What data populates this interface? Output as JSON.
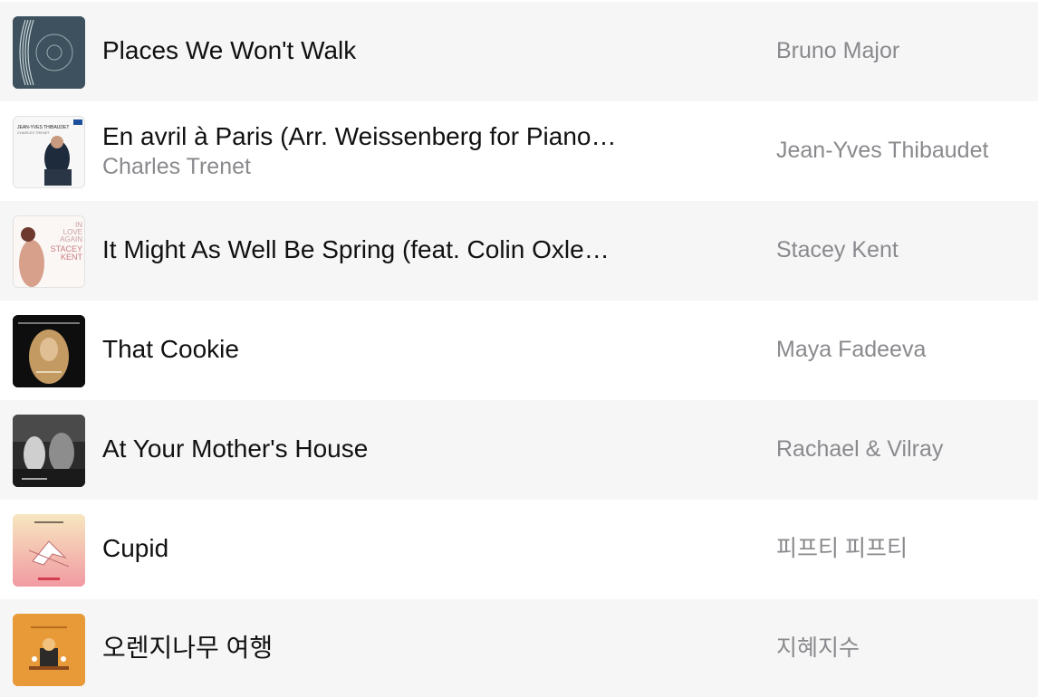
{
  "tracks": [
    {
      "title": "Places We Won't Walk",
      "subtitle": "",
      "artist": "Bruno Major",
      "art_icon": "album-art-places-we-wont-walk"
    },
    {
      "title": "En avril à Paris (Arr. Weissenberg for Piano…",
      "subtitle": "Charles Trenet",
      "artist": "Jean-Yves Thibaudet",
      "art_icon": "album-art-jean-yves-thibaudet",
      "art_text": [
        "JEAN-YVES THIBAUDET",
        "CHARLES TRENET"
      ]
    },
    {
      "title": "It Might As Well Be Spring (feat. Colin Oxle…",
      "subtitle": "",
      "artist": "Stacey Kent",
      "art_icon": "album-art-in-love-again",
      "art_text": [
        "IN",
        "LOVE",
        "AGAIN",
        "STACEY",
        "KENT"
      ]
    },
    {
      "title": "That Cookie",
      "subtitle": "",
      "artist": "Maya Fadeeva",
      "art_icon": "album-art-maya-fadeeva"
    },
    {
      "title": "At Your Mother's House",
      "subtitle": "",
      "artist": "Rachael & Vilray",
      "art_icon": "album-art-rachael-vilray"
    },
    {
      "title": "Cupid",
      "subtitle": "",
      "artist": "피프티 피프티",
      "art_icon": "album-art-cupid"
    },
    {
      "title": "오렌지나무 여행",
      "subtitle": "",
      "artist": "지혜지수",
      "art_icon": "album-art-orange-tree"
    }
  ],
  "colors": {
    "row_shaded": "#f6f6f7",
    "row_plain": "#ffffff",
    "title": "#111111",
    "secondary": "#8a8a8e"
  }
}
